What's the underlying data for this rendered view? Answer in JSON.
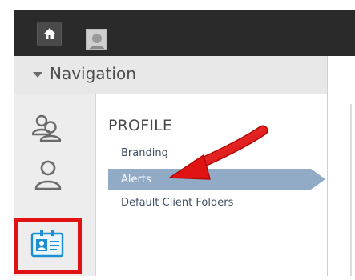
{
  "topbar": {
    "home_icon": "home-icon",
    "avatar_icon": "avatar-icon"
  },
  "navigation": {
    "title": "Navigation",
    "caret_icon": "caret-down-icon"
  },
  "sidebar": {
    "icons": [
      "clients-icon",
      "user-icon",
      "profile-card-icon"
    ],
    "highlighted": "profile-card-icon",
    "highlight_color": "#e01212"
  },
  "profile": {
    "section_title": "PROFILE",
    "items": [
      {
        "label": "Branding"
      },
      {
        "label": "Alerts",
        "selected": true
      },
      {
        "label": "Default Client Folders"
      }
    ],
    "selected_color": "#91abc6"
  },
  "annotation": {
    "arrow_color": "#e01212"
  }
}
